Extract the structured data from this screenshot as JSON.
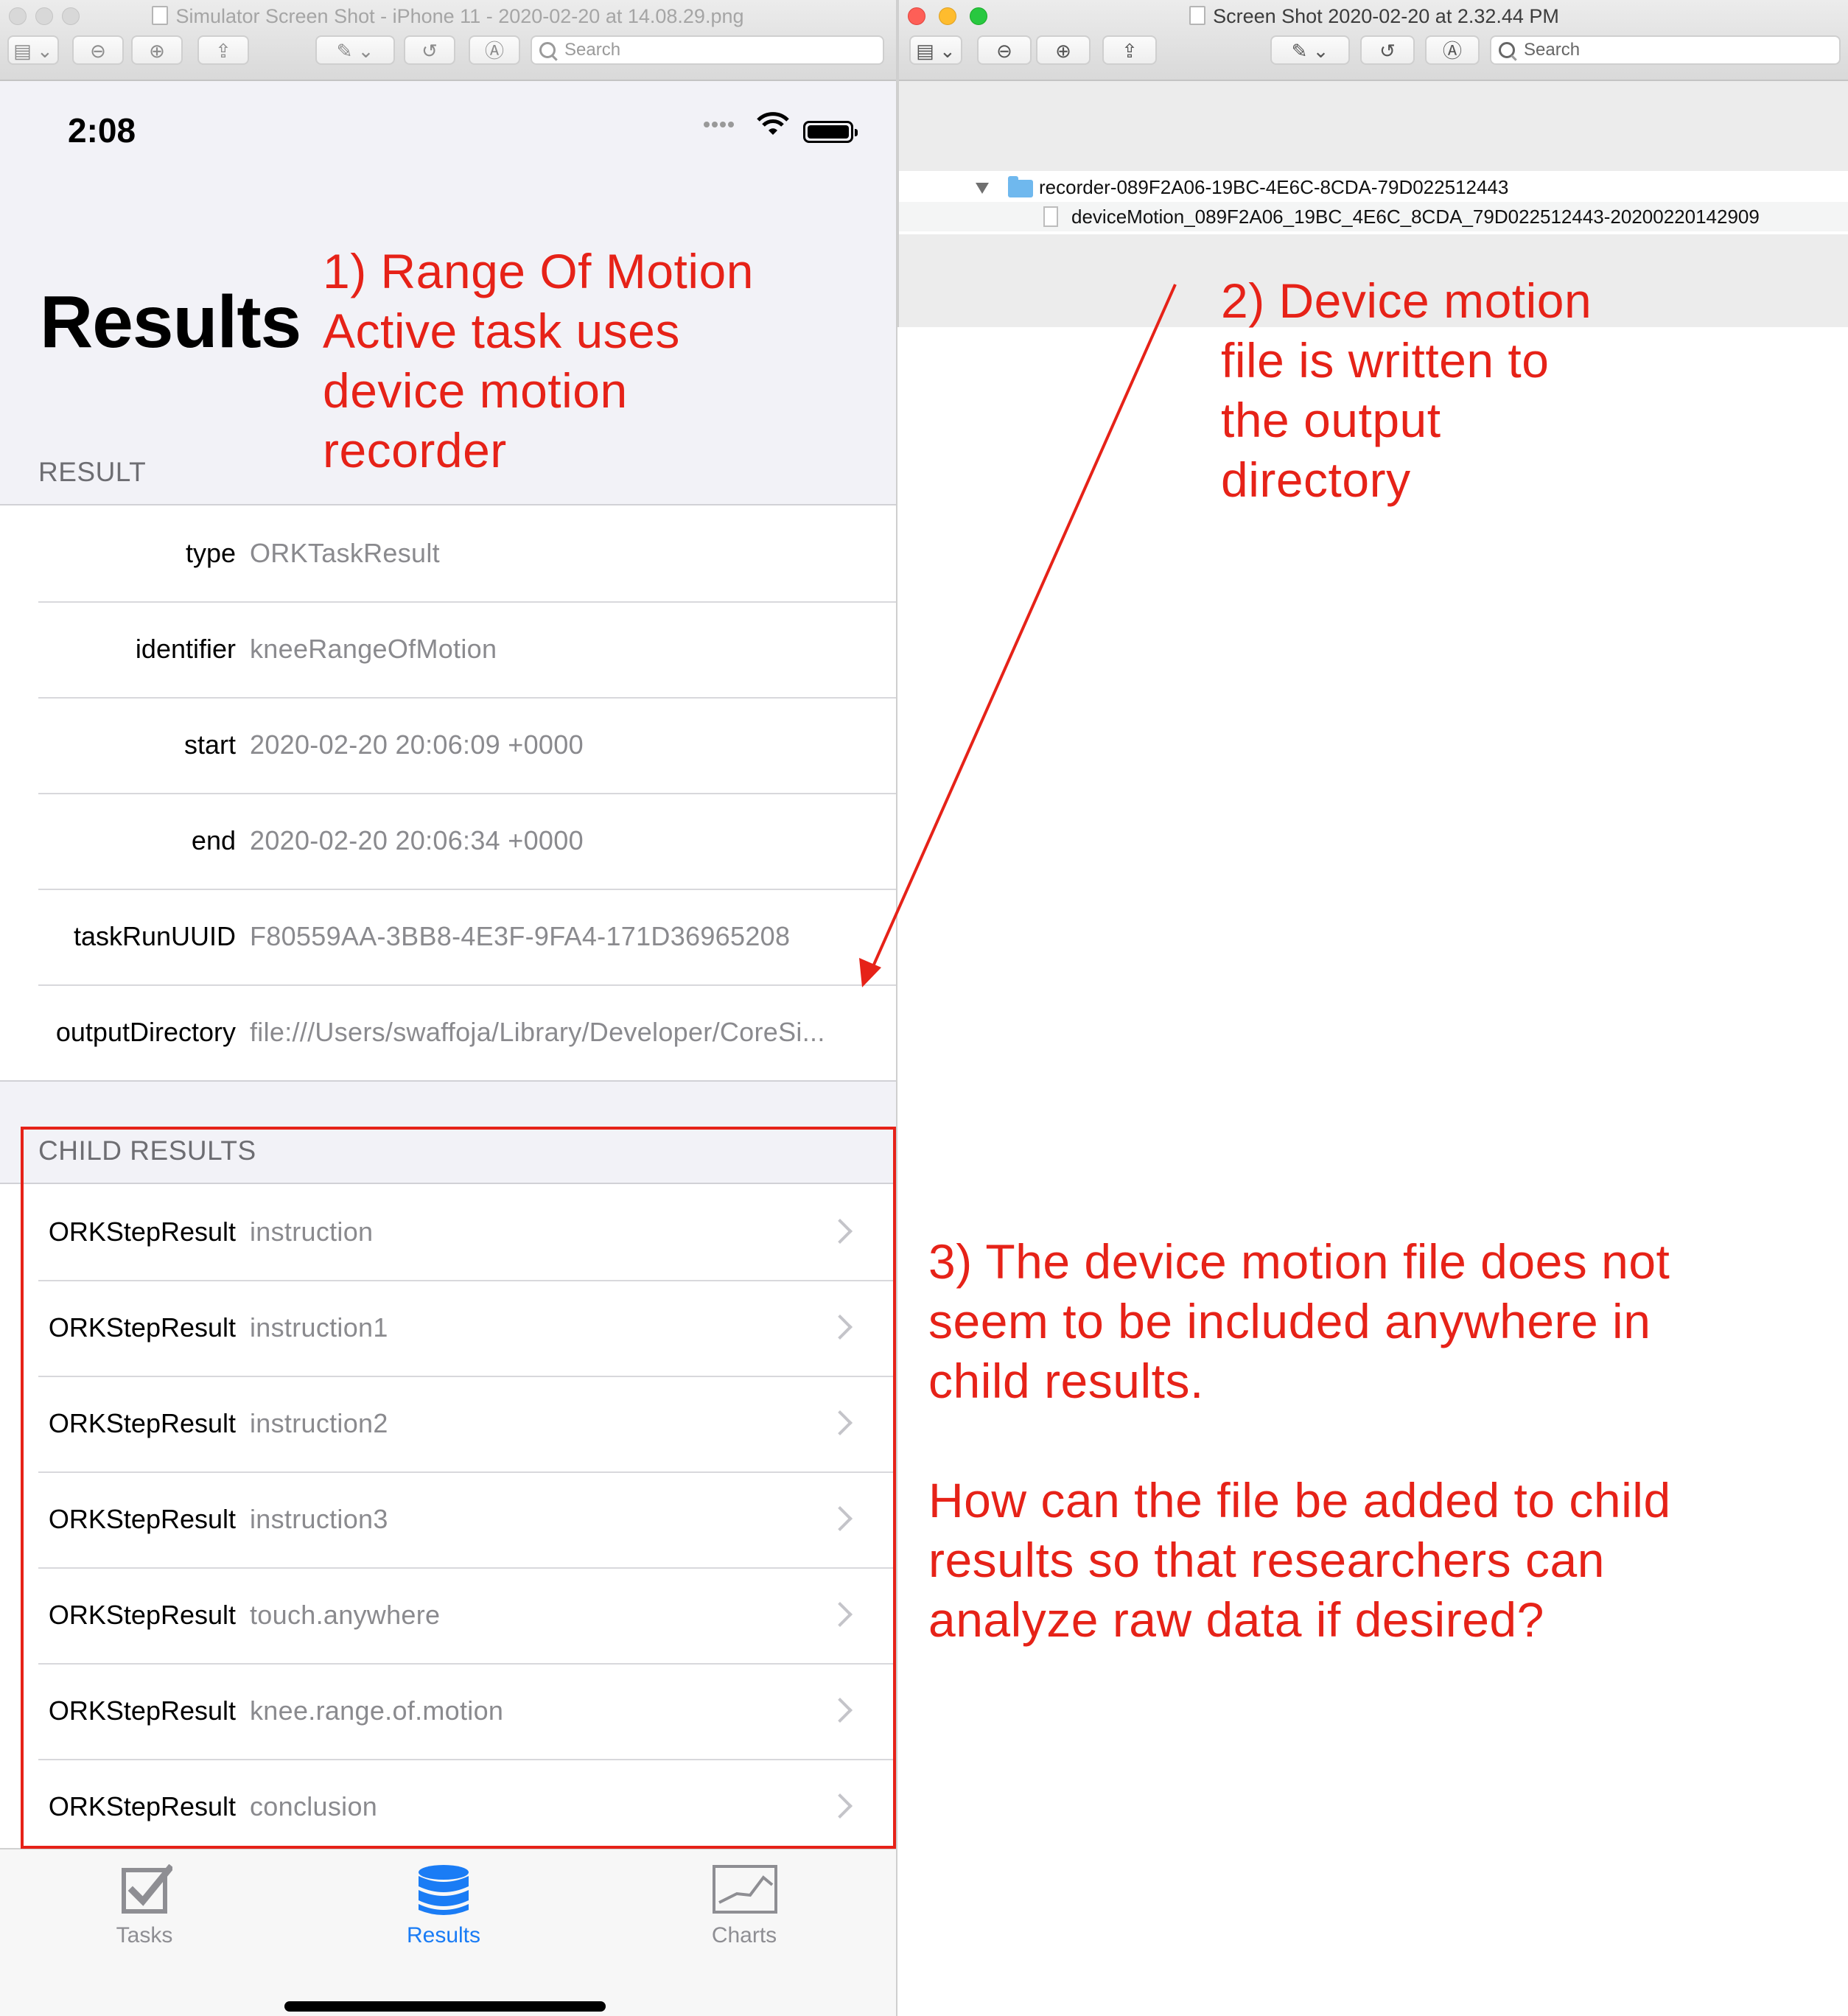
{
  "left_window": {
    "title": "Simulator Screen Shot - iPhone 11 - 2020-02-20 at 14.08.29.png",
    "search_placeholder": "Search"
  },
  "right_window": {
    "title": "Screen Shot 2020-02-20 at 2.32.44 PM",
    "search_placeholder": "Search",
    "folder_name": "recorder-089F2A06-19BC-4E6C-8CDA-79D022512443",
    "file_name": "deviceMotion_089F2A06_19BC_4E6C_8CDA_79D022512443-20200220142909"
  },
  "phone": {
    "time": "2:08",
    "large_title": "Results",
    "result_header": "RESULT",
    "result_rows": [
      {
        "label": "type",
        "value": "ORKTaskResult"
      },
      {
        "label": "identifier",
        "value": "kneeRangeOfMotion"
      },
      {
        "label": "start",
        "value": "2020-02-20 20:06:09 +0000"
      },
      {
        "label": "end",
        "value": "2020-02-20 20:06:34 +0000"
      },
      {
        "label": "taskRunUUID",
        "value": "F80559AA-3BB8-4E3F-9FA4-171D36965208"
      },
      {
        "label": "outputDirectory",
        "value": "file:///Users/swaffoja/Library/Developer/CoreSi..."
      }
    ],
    "child_header": "CHILD RESULTS",
    "child_rows": [
      {
        "label": "ORKStepResult",
        "value": "instruction"
      },
      {
        "label": "ORKStepResult",
        "value": "instruction1"
      },
      {
        "label": "ORKStepResult",
        "value": "instruction2"
      },
      {
        "label": "ORKStepResult",
        "value": "instruction3"
      },
      {
        "label": "ORKStepResult",
        "value": "touch.anywhere"
      },
      {
        "label": "ORKStepResult",
        "value": "knee.range.of.motion"
      },
      {
        "label": "ORKStepResult",
        "value": "conclusion"
      }
    ],
    "tabs": [
      {
        "label": "Tasks",
        "icon": "checkbox-icon"
      },
      {
        "label": "Results",
        "icon": "database-icon",
        "selected": true
      },
      {
        "label": "Charts",
        "icon": "line-chart-icon"
      }
    ],
    "tint_color": "#1a7cf5",
    "inactive_tab_color": "#8e8e93"
  },
  "annotations": {
    "note1": [
      "1) Range Of Motion",
      "Active task uses",
      "device motion",
      "recorder"
    ],
    "note2": [
      "2) Device motion",
      "file is written to",
      "the output",
      "directory"
    ],
    "note3": [
      "3) The device motion file does not",
      "seem to be included anywhere in",
      "child results."
    ],
    "note4": [
      "How can the file be added to child",
      "results so that researchers can",
      "analyze raw data if desired?"
    ],
    "color": "#e62218"
  }
}
